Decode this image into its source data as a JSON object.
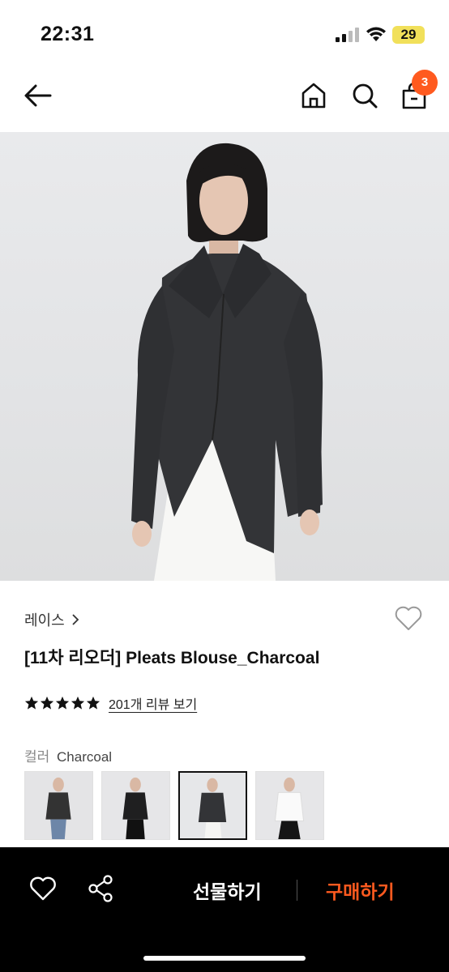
{
  "status_bar": {
    "time": "22:31",
    "battery": "29"
  },
  "nav": {
    "cart_count": "3",
    "icons": [
      "back-arrow-icon",
      "home-icon",
      "search-icon",
      "shopping-bag-icon"
    ]
  },
  "product": {
    "brand": "레이스",
    "title": "[11차 리오더] Pleats Blouse_Charcoal",
    "rating_stars": 5,
    "review_link": "201개 리뷰 보기",
    "color_label": "컬러",
    "color_value": "Charcoal",
    "selected_swatch_index": 2
  },
  "bottom_bar": {
    "gift_label": "선물하기",
    "buy_label": "구매하기"
  },
  "colors": {
    "accent": "#ff5a1f",
    "bottom_bar_bg": "#000000",
    "battery_bg": "#f1e05a"
  }
}
